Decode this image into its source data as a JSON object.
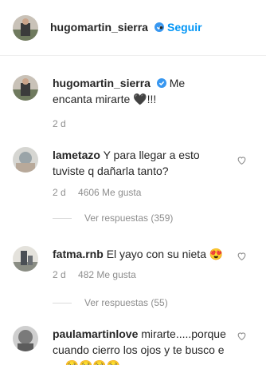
{
  "header": {
    "username": "hugomartin_sierra",
    "separator": "•",
    "follow_label": "Seguir"
  },
  "caption": {
    "username": "hugomartin_sierra",
    "text": "Me encanta mirarte 🖤!!!",
    "time": "2 d"
  },
  "comments": [
    {
      "username": "lametazo",
      "text": "Y para llegar a esto tuviste q dañarla tanto?",
      "time": "2 d",
      "likes": "4606 Me gusta",
      "replies_label": "Ver respuestas (359)"
    },
    {
      "username": "fatma.rnb",
      "text": "El yayo con su nieta 😍",
      "time": "2 d",
      "likes": "482 Me gusta",
      "replies_label": "Ver respuestas (55)"
    },
    {
      "username": "paulamartinlove",
      "text": "mirarte.....porque cuando cierro los ojos y te",
      "text_partial": "busco  e ...  🥺🥺🥺🥺"
    }
  ],
  "colors": {
    "accent": "#0095f6",
    "verified": "#3897f0",
    "muted": "#8e8e8e"
  },
  "icons": [
    "verified-badge-icon",
    "heart-icon"
  ]
}
